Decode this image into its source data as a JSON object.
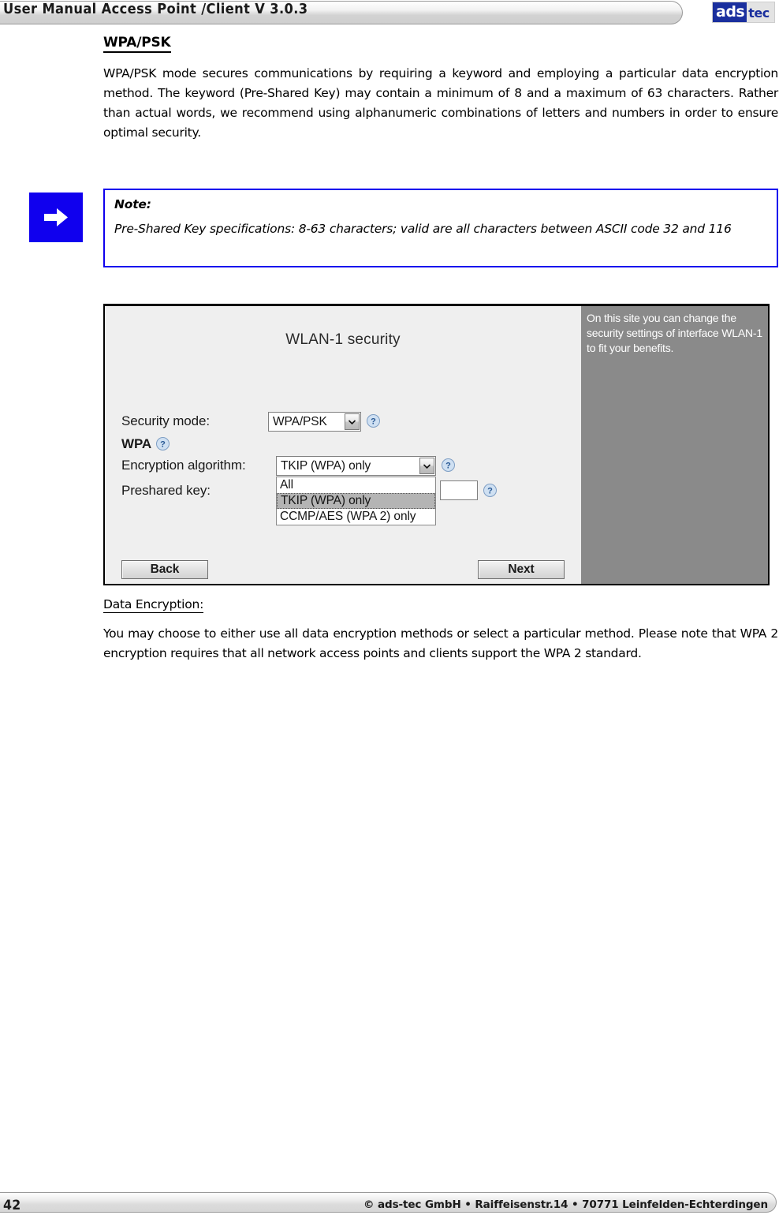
{
  "header": {
    "title": "User Manual Access Point /Client V 3.0.3",
    "logo_part1": "ads",
    "logo_part2": "tec"
  },
  "section": {
    "heading": "WPA/PSK",
    "paragraph": "WPA/PSK mode secures communications by requiring a keyword and employing a particular data encryption method. The keyword (Pre-Shared Key) may contain a minimum of 8 and a maximum of 63 characters. Rather than actual words, we recommend using alphanumeric combinations of letters and numbers in order to ensure optimal security."
  },
  "note": {
    "label": "Note:",
    "text": "Pre-Shared Key specifications: 8-63 characters; valid are all characters between ASCII code 32 and 116",
    "icon": "arrow-right-icon",
    "border_color": "#1000ee",
    "icon_bg_color": "#1000ee"
  },
  "screenshot": {
    "title": "WLAN-1 security",
    "sidebar_help": "On this site you can change the security settings of interface WLAN-1 to fit your benefits.",
    "sidebar_bg": "#8a8a8a",
    "body_bg": "#efefef",
    "fields": {
      "security_mode_label": "Security mode:",
      "security_mode_value": "WPA/PSK",
      "wpa_label": "WPA",
      "encryption_label": "Encryption algorithm:",
      "encryption_value": "TKIP (WPA) only",
      "preshared_key_label": "Preshared key:",
      "preshared_key_value": ""
    },
    "encryption_options": [
      {
        "label": "All",
        "selected": false
      },
      {
        "label": "TKIP (WPA) only",
        "selected": true
      },
      {
        "label": "CCMP/AES (WPA 2) only",
        "selected": false
      }
    ],
    "buttons": {
      "back": "Back",
      "next": "Next"
    },
    "help_icon": "question-mark-help-icon"
  },
  "data_encryption": {
    "heading": "Data Encryption:",
    "paragraph": "You may choose to either use all data encryption methods or select a particular method. Please note that WPA 2 encryption requires that all network access points and clients support the WPA 2 standard."
  },
  "footer": {
    "page_number": "42",
    "copyright": "© ads-tec GmbH • Raiffeisenstr.14 • 70771 Leinfelden-Echterdingen"
  }
}
